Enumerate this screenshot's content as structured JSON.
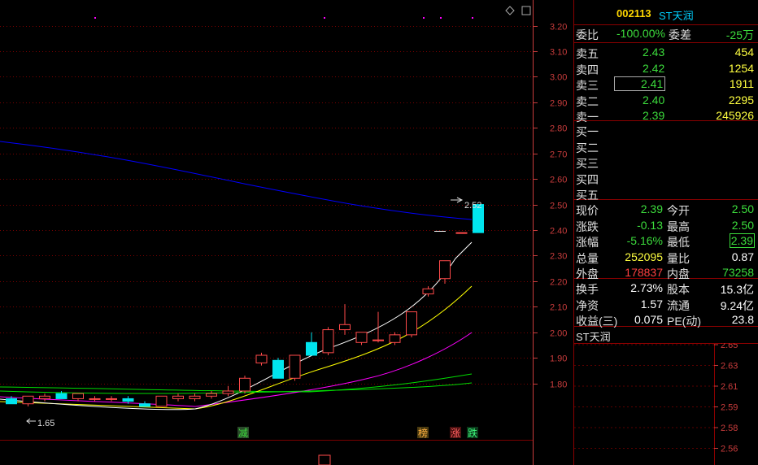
{
  "colors": {
    "up": "#ff4a4a",
    "down": "#00e5ee",
    "ma1": "#ffffff",
    "ma2": "#ffff00",
    "ma3": "#ff00ff",
    "ma4": "#00dd00",
    "ma5": "#0000ff",
    "grid": "#7a0000",
    "axis": "#c83c3c"
  },
  "header": {
    "code": "002113",
    "name": "ST天润"
  },
  "order_ratio": {
    "label": "委比",
    "value": "-100.00%",
    "diff_label": "委差",
    "diff_value": "-25万"
  },
  "asks": [
    {
      "label": "卖五",
      "price": "2.43",
      "vol": "454"
    },
    {
      "label": "卖四",
      "price": "2.42",
      "vol": "1254"
    },
    {
      "label": "卖三",
      "price": "2.41",
      "vol": "1911"
    },
    {
      "label": "卖二",
      "price": "2.40",
      "vol": "2295"
    },
    {
      "label": "卖一",
      "price": "2.39",
      "vol": "245926"
    }
  ],
  "bids": [
    {
      "label": "买一"
    },
    {
      "label": "买二"
    },
    {
      "label": "买三"
    },
    {
      "label": "买四"
    },
    {
      "label": "买五"
    }
  ],
  "quote": [
    {
      "l1": "现价",
      "v1": "2.39",
      "l2": "今开",
      "v2": "2.50"
    },
    {
      "l1": "涨跌",
      "v1": "-0.13",
      "l2": "最高",
      "v2": "2.50"
    },
    {
      "l1": "涨幅",
      "v1": "-5.16%",
      "l2": "最低",
      "v2": "2.39"
    },
    {
      "l1": "总量",
      "v1": "252095",
      "l2": "量比",
      "v2": "0.87"
    },
    {
      "l1": "外盘",
      "v1": "178837",
      "l2": "内盘",
      "v2": "73258"
    }
  ],
  "fundamentals": [
    {
      "l1": "换手",
      "v1": "2.73%",
      "l2": "股本",
      "v2": "15.3亿"
    },
    {
      "l1": "净资",
      "v1": "1.57",
      "l2": "流通",
      "v2": "9.24亿"
    },
    {
      "l1": "收益(三)",
      "v1": "0.075",
      "l2": "PE(动)",
      "v2": "23.8"
    }
  ],
  "mini_chart": {
    "title": "ST天润",
    "ticks": [
      "2.65",
      "2.63",
      "2.61",
      "2.59",
      "2.58",
      "2.56"
    ]
  },
  "chart_data": {
    "type": "candlestick",
    "y_ticks": [
      "3.20",
      "3.10",
      "3.00",
      "2.90",
      "2.80",
      "2.70",
      "2.60",
      "2.50",
      "2.40",
      "2.30",
      "2.20",
      "2.10",
      "2.00",
      "1.90",
      "1.80"
    ],
    "ylim": [
      1.7,
      3.24
    ],
    "annotations": {
      "high": "2.52",
      "low": "1.65"
    },
    "markers": [
      "减",
      "榜",
      "涨",
      "跌"
    ],
    "candles": [
      {
        "o": 1.74,
        "h": 1.75,
        "l": 1.72,
        "c": 1.72
      },
      {
        "o": 1.72,
        "h": 1.75,
        "l": 1.71,
        "c": 1.75
      },
      {
        "o": 1.74,
        "h": 1.76,
        "l": 1.73,
        "c": 1.75
      },
      {
        "o": 1.76,
        "h": 1.77,
        "l": 1.74,
        "c": 1.74
      },
      {
        "o": 1.74,
        "h": 1.76,
        "l": 1.73,
        "c": 1.76
      },
      {
        "o": 1.74,
        "h": 1.75,
        "l": 1.73,
        "c": 1.74
      },
      {
        "o": 1.74,
        "h": 1.75,
        "l": 1.73,
        "c": 1.74
      },
      {
        "o": 1.74,
        "h": 1.75,
        "l": 1.72,
        "c": 1.73
      },
      {
        "o": 1.72,
        "h": 1.73,
        "l": 1.71,
        "c": 1.71
      },
      {
        "o": 1.71,
        "h": 1.75,
        "l": 1.71,
        "c": 1.75
      },
      {
        "o": 1.74,
        "h": 1.76,
        "l": 1.73,
        "c": 1.75
      },
      {
        "o": 1.74,
        "h": 1.76,
        "l": 1.73,
        "c": 1.75
      },
      {
        "o": 1.75,
        "h": 1.77,
        "l": 1.74,
        "c": 1.76
      },
      {
        "o": 1.76,
        "h": 1.79,
        "l": 1.75,
        "c": 1.77
      },
      {
        "o": 1.77,
        "h": 1.83,
        "l": 1.76,
        "c": 1.82
      },
      {
        "o": 1.88,
        "h": 1.92,
        "l": 1.87,
        "c": 1.91
      },
      {
        "o": 1.89,
        "h": 1.9,
        "l": 1.82,
        "c": 1.82
      },
      {
        "o": 1.82,
        "h": 1.91,
        "l": 1.81,
        "c": 1.91
      },
      {
        "o": 1.96,
        "h": 2.0,
        "l": 1.91,
        "c": 1.91
      },
      {
        "o": 1.92,
        "h": 2.02,
        "l": 1.91,
        "c": 2.01
      },
      {
        "o": 2.01,
        "h": 2.11,
        "l": 1.99,
        "c": 2.03
      },
      {
        "o": 1.96,
        "h": 2.0,
        "l": 1.95,
        "c": 2.0
      },
      {
        "o": 1.97,
        "h": 2.08,
        "l": 1.96,
        "c": 1.97
      },
      {
        "o": 1.96,
        "h": 2.0,
        "l": 1.95,
        "c": 1.99
      },
      {
        "o": 1.99,
        "h": 2.08,
        "l": 1.98,
        "c": 2.08
      },
      {
        "o": 2.15,
        "h": 2.18,
        "l": 2.14,
        "c": 2.17
      },
      {
        "o": 2.21,
        "h": 2.28,
        "l": 2.19,
        "c": 2.28
      },
      {
        "o": 2.39,
        "h": 2.39,
        "l": 2.39,
        "c": 2.39
      },
      {
        "o": 2.5,
        "h": 2.5,
        "l": 2.39,
        "c": 2.39
      }
    ]
  }
}
